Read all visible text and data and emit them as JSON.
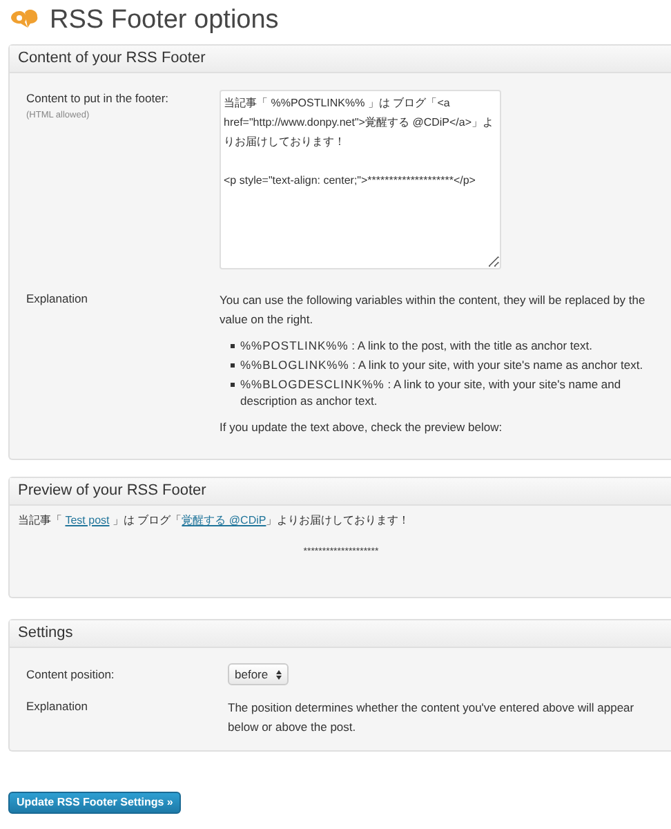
{
  "page_title": "RSS Footer options",
  "content_panel": {
    "title": "Content of your RSS Footer",
    "footer_field": {
      "label": "Content to put in the footer:",
      "hint": "(HTML allowed)",
      "value": "当記事「 %%POSTLINK%% 」は ブログ「<a href=\"http://www.donpy.net\">覚醒する @CDiP</a>」よりお届けしております！\n\n<p style=\"text-align: center;\">********************</p>"
    },
    "explanation": {
      "label": "Explanation",
      "intro": "You can use the following variables within the content, they will be replaced by the value on the right.",
      "variables": [
        {
          "name": "%%POSTLINK%%",
          "text": " : A link to the post, with the title as anchor text."
        },
        {
          "name": "%%BLOGLINK%%",
          "text": " : A link to your site, with your site's name as anchor text."
        },
        {
          "name": "%%BLOGDESCLINK%%",
          "text": " : A link to your site, with your site's name and description as anchor text."
        }
      ],
      "outro": "If you update the text above, check the preview below:"
    }
  },
  "preview_panel": {
    "title": "Preview of your RSS Footer",
    "sentence": [
      {
        "kind": "text",
        "text": "当記事「 "
      },
      {
        "kind": "link",
        "text": "Test post"
      },
      {
        "kind": "text",
        "text": " 」は ブログ「"
      },
      {
        "kind": "link",
        "text": "覚醒する @CDiP"
      },
      {
        "kind": "text",
        "text": "」よりお届けしております！"
      }
    ],
    "centered": "********************"
  },
  "settings_panel": {
    "title": "Settings",
    "position": {
      "label": "Content position:",
      "value": "before"
    },
    "explanation": {
      "label": "Explanation",
      "text": "The position determines whether the content you've entered above will appear below or above the post."
    }
  },
  "submit_button": "Update RSS Footer Settings »"
}
